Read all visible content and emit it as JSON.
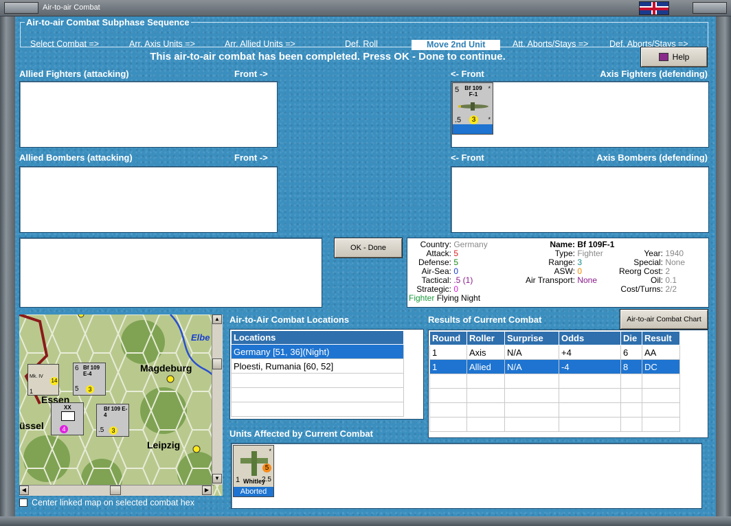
{
  "window": {
    "title": "Air-to-air Combat"
  },
  "sequence": {
    "title": "Air-to-air Combat Subphase Sequence",
    "steps": [
      "Select Combat =>",
      "Arr. Axis Units =>",
      "Arr. Allied Units =>",
      "Def. Roll",
      "Move 2nd Unit",
      "Att. Aborts/Stays =>",
      "Def. Aborts/Stays =>"
    ],
    "active_step": "Move 2nd Unit"
  },
  "message": "This air-to-air combat has been completed.  Press OK - Done to continue.",
  "help_label": "Help",
  "sections": {
    "allied_fighters": "Allied Fighters (attacking)",
    "allied_bombers": "Allied Bombers (attacking)",
    "axis_fighters": "Axis Fighters (defending)",
    "axis_bombers": "Axis Bombers (defending)",
    "front_right": "Front ->",
    "front_left": "<- Front"
  },
  "axis_fighter_counter": {
    "name_line1": "Bf 109",
    "name_line2": "F-1",
    "tl": "5",
    "star": "*",
    "bl": ".5",
    "circle": "3",
    "br": "*"
  },
  "ok_done_label": "OK - Done",
  "unit_info": {
    "country_label": "Country:",
    "country": "Germany",
    "attack_label": "Attack:",
    "attack": "5",
    "defense_label": "Defense:",
    "defense": "5",
    "airsea_label": "Air-Sea:",
    "airsea": "0",
    "tactical_label": "Tactical:",
    "tactical": ".5 (1)",
    "strategic_label": "Strategic:",
    "strategic": "0",
    "fighter_tag": "Fighter",
    "flying_night": "Flying Night",
    "name_label": "Name:",
    "name": "Bf 109F-1",
    "type_label": "Type:",
    "type": "Fighter",
    "range_label": "Range:",
    "range": "3",
    "asw_label": "ASW:",
    "asw": "0",
    "air_transport_label": "Air Transport:",
    "air_transport": "None",
    "year_label": "Year:",
    "year": "1940",
    "special_label": "Special:",
    "special": "None",
    "reorg_label": "Reorg Cost:",
    "reorg": "2",
    "oil_label": "Oil:",
    "oil": "0.1",
    "cost_label": "Cost/Turns:",
    "cost": "2/2",
    "colors": {
      "attack": "#d81e1e",
      "defense": "#1a8a1a",
      "airsea": "#1a3fd0",
      "tactical": "#8a1a8a",
      "strategic": "#d81ed8",
      "range": "#1a8a8a",
      "asw": "#f08a00",
      "air_transport": "#8a1a8a",
      "fighter": "#1a9a3a"
    }
  },
  "map": {
    "cities": [
      "Magdeburg",
      "Leipzig",
      "Essen",
      "üssel"
    ],
    "river": "Elbe",
    "counters": [
      {
        "name": "Bf 109 E-4",
        "sub": "Emil",
        "tl": "6",
        "bl": "5",
        "circle": "3"
      },
      {
        "name": "Bf 109 E-4",
        "sub": "",
        "tl": "",
        "bl": ".5",
        "circle": "3"
      },
      {
        "name": "Mk. IV",
        "sub": "Blenheim",
        "tl": "",
        "bl": "1",
        "circle": "14"
      },
      {
        "name": "XX",
        "sub": "",
        "tl": "",
        "bl": "",
        "circle": "4"
      }
    ],
    "center_checkbox_label": "Center linked map on selected combat hex"
  },
  "locations": {
    "title": "Air-to-Air Combat Locations",
    "header": "Locations",
    "rows": [
      "Germany [51, 36](Night)",
      "Ploesti, Rumania [60, 52]",
      "",
      "",
      "",
      ""
    ],
    "selected": 0
  },
  "results": {
    "title": "Results of Current Combat",
    "chart_button": "Air-to-air Combat Chart",
    "headers": [
      "Round",
      "Roller",
      "Surprise",
      "Odds",
      "Die",
      "Result"
    ],
    "rows": [
      [
        "1",
        "Axis",
        "N/A",
        "+4",
        "6",
        "AA"
      ],
      [
        "1",
        "Allied",
        "N/A",
        "-4",
        "8",
        "DC"
      ],
      [
        "",
        "",
        "",
        "",
        "",
        ""
      ],
      [
        "",
        "",
        "",
        "",
        "",
        ""
      ],
      [
        "",
        "",
        "",
        "",
        "",
        ""
      ],
      [
        "",
        "",
        "",
        "",
        "",
        ""
      ]
    ],
    "selected": 1
  },
  "affected": {
    "title": "Units Affected by Current Combat",
    "counter": {
      "name": "Whitley",
      "tl": "1",
      "star": "*",
      "circle": "5",
      "br": "2.5",
      "bar": "Aborted"
    }
  }
}
